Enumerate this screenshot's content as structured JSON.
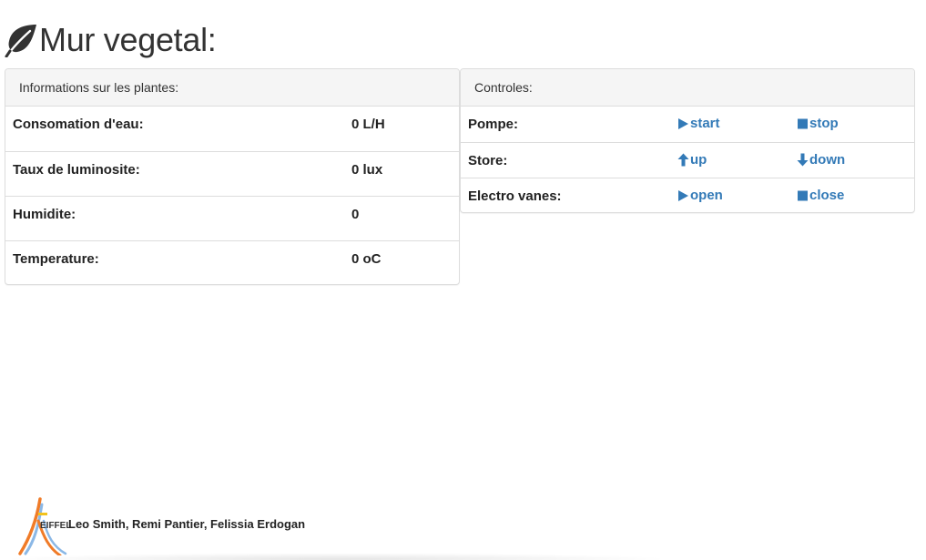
{
  "header": {
    "title": "Mur vegetal:",
    "icon": "leaf-icon"
  },
  "info_panel": {
    "heading": "Informations sur les plantes:",
    "rows": [
      {
        "label": "Consomation d'eau:",
        "value": "0 L/H"
      },
      {
        "label": "Taux de luminosite:",
        "value": "0 lux"
      },
      {
        "label": "Humidite:",
        "value": "0"
      },
      {
        "label": "Temperature:",
        "value": "0 oC"
      }
    ]
  },
  "controls_panel": {
    "heading": "Controles:",
    "rows": [
      {
        "label": "Pompe:",
        "action_a": "start",
        "icon_a": "play-icon",
        "action_b": "stop",
        "icon_b": "stop-icon"
      },
      {
        "label": "Store:",
        "action_a": "up",
        "icon_a": "arrow-up-icon",
        "action_b": "down",
        "icon_b": "arrow-down-icon"
      },
      {
        "label": "Electro vanes:",
        "action_a": "open",
        "icon_a": "play-icon",
        "action_b": "close",
        "icon_b": "stop-icon"
      }
    ]
  },
  "footer": {
    "logo_text": "EIFFEL",
    "credits": "Leo Smith, Remi Pantier, Felissia Erdogan"
  },
  "colors": {
    "link": "#337ab7",
    "panel_heading_bg": "#f5f5f5",
    "border": "#dddddd",
    "text": "#333333"
  }
}
